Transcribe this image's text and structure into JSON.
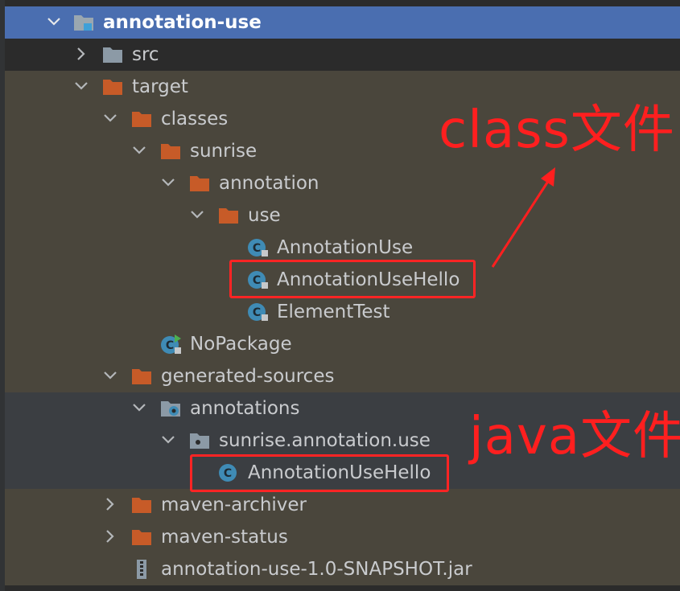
{
  "tree": {
    "root": {
      "label": "annotation-use",
      "expanded": true
    },
    "src": {
      "label": "src",
      "expanded": false
    },
    "target": {
      "label": "target",
      "expanded": true
    },
    "classes": {
      "label": "classes",
      "expanded": true
    },
    "sunrise": {
      "label": "sunrise",
      "expanded": true
    },
    "annotation": {
      "label": "annotation",
      "expanded": true
    },
    "use": {
      "label": "use",
      "expanded": true
    },
    "class_annotation_use": {
      "label": "AnnotationUse"
    },
    "class_annotation_use_hello": {
      "label": "AnnotationUseHello"
    },
    "class_element_test": {
      "label": "ElementTest"
    },
    "class_no_package": {
      "label": "NoPackage"
    },
    "generated_sources": {
      "label": "generated-sources",
      "expanded": true
    },
    "annotations": {
      "label": "annotations",
      "expanded": true
    },
    "package_sunrise_annotation_use": {
      "label": "sunrise.annotation.use",
      "expanded": true
    },
    "java_annotation_use_hello": {
      "label": "AnnotationUseHello"
    },
    "maven_archiver": {
      "label": "maven-archiver",
      "expanded": false
    },
    "maven_status": {
      "label": "maven-status",
      "expanded": false
    },
    "jar": {
      "label": "annotation-use-1.0-SNAPSHOT.jar"
    }
  },
  "annotations_overlay": {
    "class_note": "class文件",
    "java_note": "java文件"
  },
  "colors": {
    "background": "#2b2b2b",
    "excluded_row": "#4a463c",
    "generated_row": "#3b3e42",
    "selected_row": "#4a6eb0",
    "folder_excluded": "#c75b28",
    "folder_normal": "#8c9aa6",
    "class_icon": "#3f8bb5",
    "annotation_red": "#ff1f1f"
  }
}
